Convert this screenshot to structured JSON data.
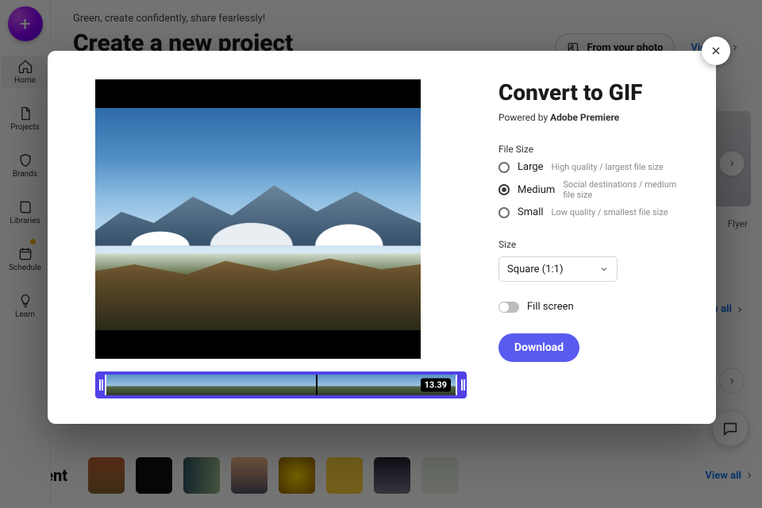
{
  "sidebar": {
    "items": [
      {
        "label": "Home"
      },
      {
        "label": "Projects"
      },
      {
        "label": "Brands"
      },
      {
        "label": "Libraries"
      },
      {
        "label": "Schedule"
      },
      {
        "label": "Learn"
      }
    ]
  },
  "page": {
    "greeting": "Green, create confidently, share fearlessly!",
    "title": "Create a new project",
    "from_photo": "From your photo",
    "view_all": "View all",
    "peek_label": "Flyer",
    "recent_title": "Recent"
  },
  "modal": {
    "title": "Convert to GIF",
    "powered_pre": "Powered by ",
    "powered_brand": "Adobe Premiere",
    "file_size_label": "File Size",
    "options": [
      {
        "name": "Large",
        "desc": "High quality / largest file size",
        "selected": false
      },
      {
        "name": "Medium",
        "desc": "Social destinations / medium file size",
        "selected": true
      },
      {
        "name": "Small",
        "desc": "Low quality / smallest file size",
        "selected": false
      }
    ],
    "size_label": "Size",
    "size_value": "Square (1:1)",
    "fill_screen": "Fill screen",
    "download": "Download",
    "timecode": "13.39"
  },
  "colors": {
    "accent": "#595bf0"
  }
}
